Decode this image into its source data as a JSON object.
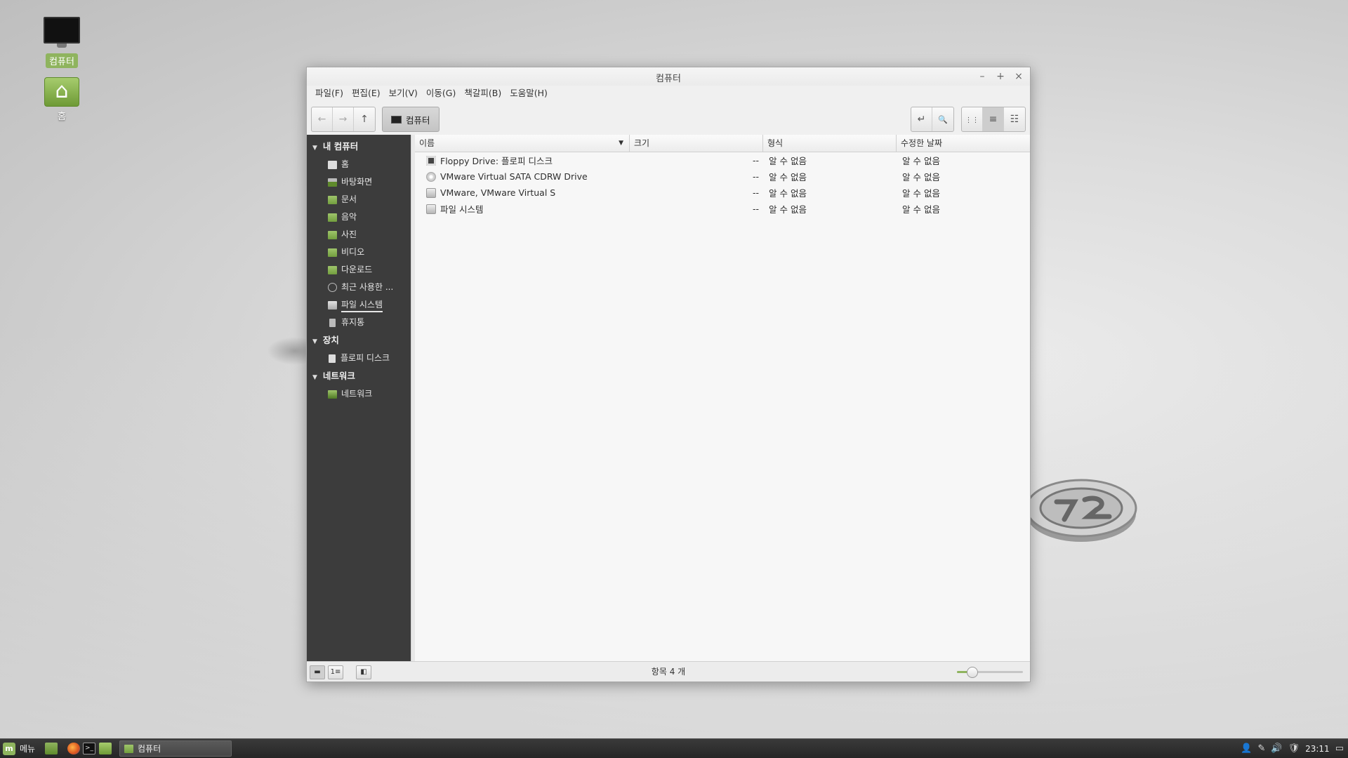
{
  "desktop": {
    "icons": [
      {
        "label": "컴퓨터",
        "icon": "computer-icon"
      },
      {
        "label": "홈",
        "icon": "home-folder-icon"
      }
    ]
  },
  "window": {
    "title": "컴퓨터",
    "controls": {
      "minimize": "–",
      "maximize": "+",
      "close": "×"
    },
    "menu": [
      "파일(F)",
      "편집(E)",
      "보기(V)",
      "이동(G)",
      "책갈피(B)",
      "도움말(H)"
    ],
    "toolbar": {
      "back_icon": "←",
      "forward_icon": "→",
      "up_icon": "↑",
      "location_label": "컴퓨터",
      "toggle_location_icon": "↵",
      "search_icon": "🔍",
      "view_icons": "⋮⋮",
      "view_list": "≡",
      "view_compact": "☷"
    },
    "sidebar": {
      "sections": [
        {
          "title": "내 컴퓨터",
          "items": [
            {
              "label": "홈",
              "icon": "home"
            },
            {
              "label": "바탕화면",
              "icon": "desk"
            },
            {
              "label": "문서",
              "icon": "folder"
            },
            {
              "label": "음악",
              "icon": "folder"
            },
            {
              "label": "사진",
              "icon": "folder"
            },
            {
              "label": "비디오",
              "icon": "folder"
            },
            {
              "label": "다운로드",
              "icon": "folder"
            },
            {
              "label": "최근 사용한 ...",
              "icon": "clock"
            },
            {
              "label": "파일 시스템",
              "icon": "drive"
            },
            {
              "label": "휴지통",
              "icon": "trash"
            }
          ]
        },
        {
          "title": "장치",
          "items": [
            {
              "label": "플로피 디스크",
              "icon": "floppy"
            }
          ]
        },
        {
          "title": "네트워크",
          "items": [
            {
              "label": "네트워크",
              "icon": "net"
            }
          ]
        }
      ]
    },
    "columns": [
      "이름",
      "크기",
      "형식",
      "수정한 날짜"
    ],
    "rows": [
      {
        "name": "Floppy Drive: 플로피 디스크",
        "size": "--",
        "type": "알 수 없음",
        "modified": "알 수 없음",
        "icon": "floppy"
      },
      {
        "name": "VMware Virtual SATA CDRW Drive",
        "size": "--",
        "type": "알 수 없음",
        "modified": "알 수 없음",
        "icon": "cd"
      },
      {
        "name": "VMware, VMware Virtual S",
        "size": "--",
        "type": "알 수 없음",
        "modified": "알 수 없음",
        "icon": "drive"
      },
      {
        "name": "파일 시스템",
        "size": "--",
        "type": "알 수 없음",
        "modified": "알 수 없음",
        "icon": "drive"
      }
    ],
    "status": {
      "text": "항목 4 개",
      "btn_places": "▬",
      "btn_tree": "1≡",
      "btn_hide": "◧",
      "zoom_fraction": 0.18
    }
  },
  "taskbar": {
    "menu_label": "메뉴",
    "task_title": "컴퓨터",
    "clock": "23:11",
    "tray_icons": [
      "👤",
      "✎",
      "🔊",
      "🛡",
      "▭"
    ]
  },
  "colors": {
    "accent": "#8fb45e",
    "sidebar_bg": "#3c3c3c"
  }
}
